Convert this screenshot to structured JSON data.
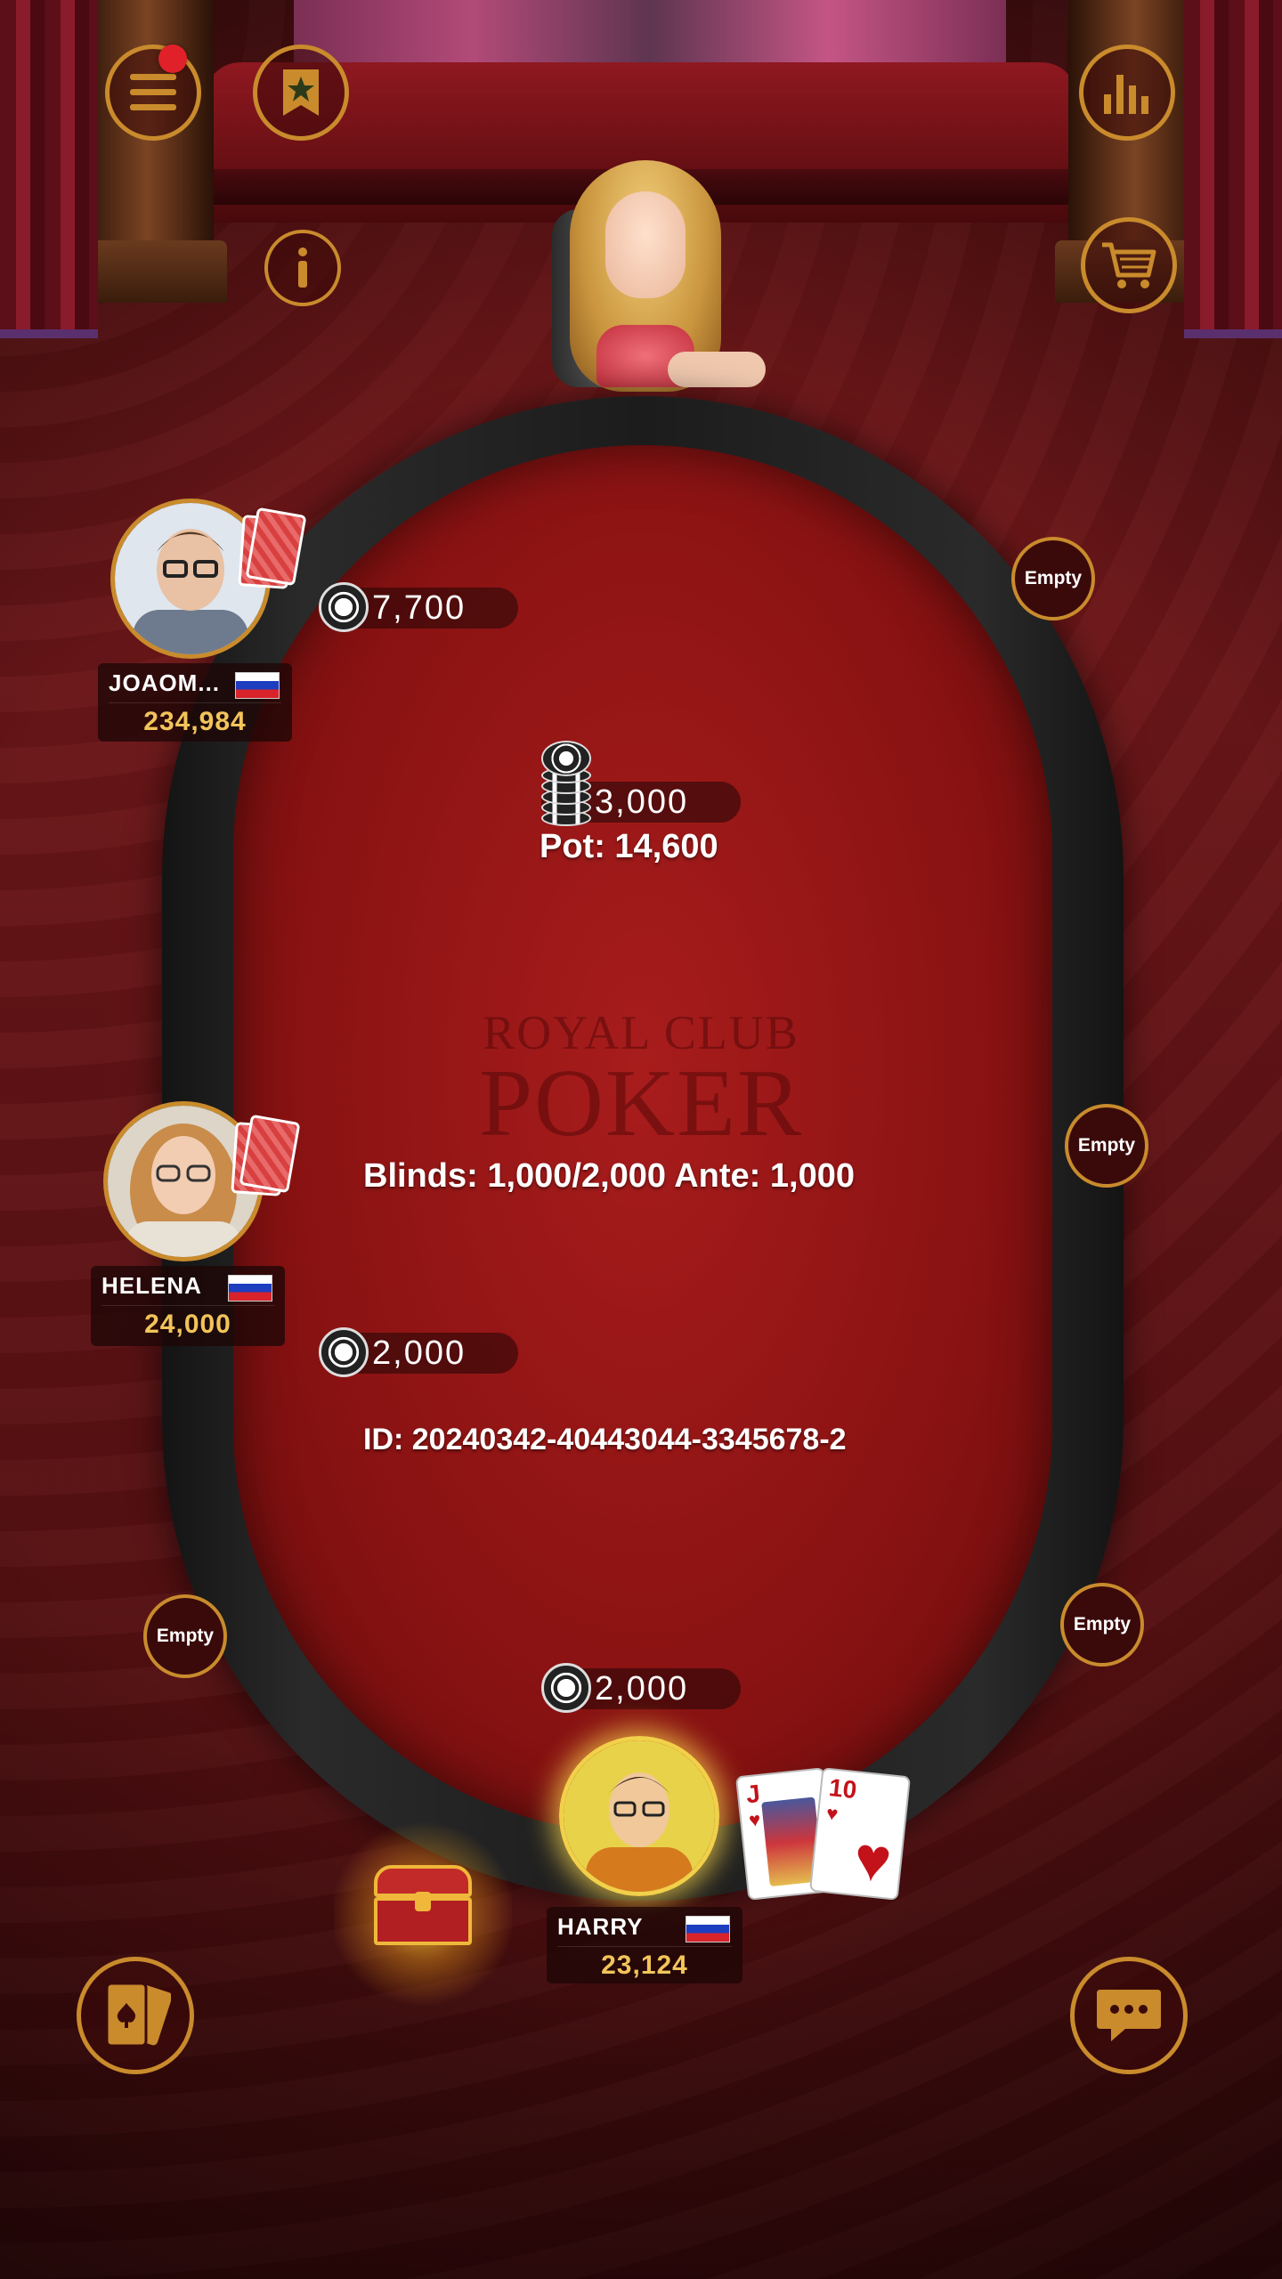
{
  "top_bar": {
    "menu_icon": "hamburger-menu-icon",
    "bookmark_icon": "star-bookmark-icon",
    "info_icon": "info-icon",
    "leaderboard_icon": "bar-chart-icon",
    "shop_icon": "shopping-cart-icon",
    "notification": true
  },
  "table": {
    "watermark_top": "ROYAL CLUB",
    "watermark_bottom": "POKER",
    "pot_bet": "3,000",
    "pot_label": "Pot: 14,600",
    "blinds_label": "Blinds: 1,000/2,000  Ante: 1,000",
    "id_label": "ID: 20240342-40443044-3345678-2"
  },
  "players": [
    {
      "name": "JOAOM...",
      "chips": "234,984",
      "bet": "7,700",
      "flag": "ru"
    },
    {
      "name": "HELENA",
      "chips": "24,000",
      "bet": "2,000",
      "flag": "ru"
    },
    {
      "name": "HARRY",
      "chips": "23,124",
      "bet": "2,000",
      "flag": "ru"
    }
  ],
  "hero_cards": [
    {
      "rank": "J",
      "suit": "♥"
    },
    {
      "rank": "10",
      "suit": "♥"
    }
  ],
  "empty_seats": [
    "Empty",
    "Empty",
    "Empty",
    "Empty"
  ],
  "bottom_bar": {
    "cards_icon": "playing-cards-icon",
    "chat_icon": "chat-bubble-icon",
    "chest_icon": "treasure-chest-icon"
  },
  "colors": {
    "accent_gold": "#c98b2c",
    "felt_red": "#a81c1c",
    "chip_text": "#f2c45a"
  }
}
